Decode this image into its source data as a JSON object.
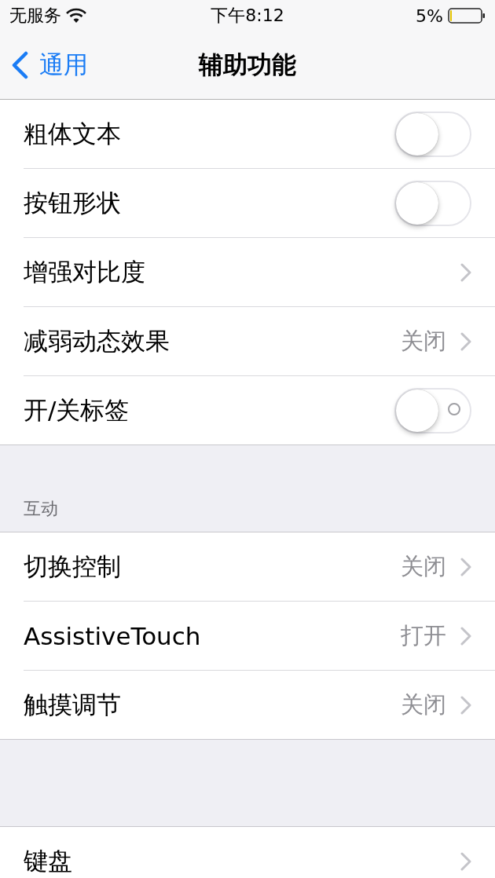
{
  "status_bar": {
    "carrier": "无服务",
    "time": "下午8:12",
    "battery": {
      "percent": "5%"
    }
  },
  "nav": {
    "back": "通用",
    "title": "辅助功能"
  },
  "sections": [
    {
      "rows": [
        {
          "kind": "switch",
          "label": "粗体文本",
          "on": false,
          "show_label": false
        },
        {
          "kind": "switch",
          "label": "按钮形状",
          "on": false,
          "show_label": false
        },
        {
          "kind": "link",
          "label": "增强对比度"
        },
        {
          "kind": "link",
          "label": "减弱动态效果",
          "value": "关闭"
        },
        {
          "kind": "switch",
          "label": "开/关标签",
          "on": false,
          "show_label": true
        }
      ]
    },
    {
      "header": "互动",
      "rows": [
        {
          "kind": "link",
          "label": "切换控制",
          "value": "关闭"
        },
        {
          "kind": "link",
          "label": "AssistiveTouch",
          "value": "打开"
        },
        {
          "kind": "link",
          "label": "触摸调节",
          "value": "关闭"
        }
      ]
    },
    {
      "rows": [
        {
          "kind": "link",
          "label": "键盘"
        }
      ]
    }
  ]
}
